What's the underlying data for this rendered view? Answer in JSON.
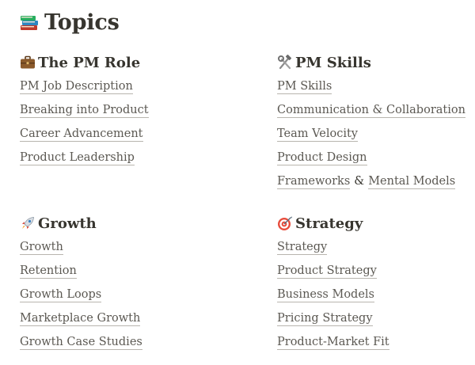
{
  "page": {
    "icon": "books-icon",
    "title": "Topics"
  },
  "sections": [
    {
      "icon": "briefcase-icon",
      "title": "The PM Role",
      "links": [
        "PM Job Description",
        "Breaking into Product",
        "Career Advancement",
        "Product Leadership"
      ]
    },
    {
      "icon": "hammer-wrench-icon",
      "title": "PM Skills",
      "links": [
        "PM Skills",
        "Communication & Collaboration",
        "Team Velocity",
        "Product Design"
      ],
      "combined_link": {
        "left": "Frameworks",
        "separator": "&",
        "right": "Mental Models"
      }
    },
    {
      "icon": "rocket-icon",
      "title": "Growth",
      "links": [
        "Growth",
        "Retention",
        "Growth Loops",
        "Marketplace Growth",
        "Growth Case Studies"
      ]
    },
    {
      "icon": "target-icon",
      "title": "Strategy",
      "links": [
        "Strategy",
        "Product Strategy",
        "Business Models",
        "Pricing Strategy",
        "Product-Market Fit"
      ]
    }
  ]
}
